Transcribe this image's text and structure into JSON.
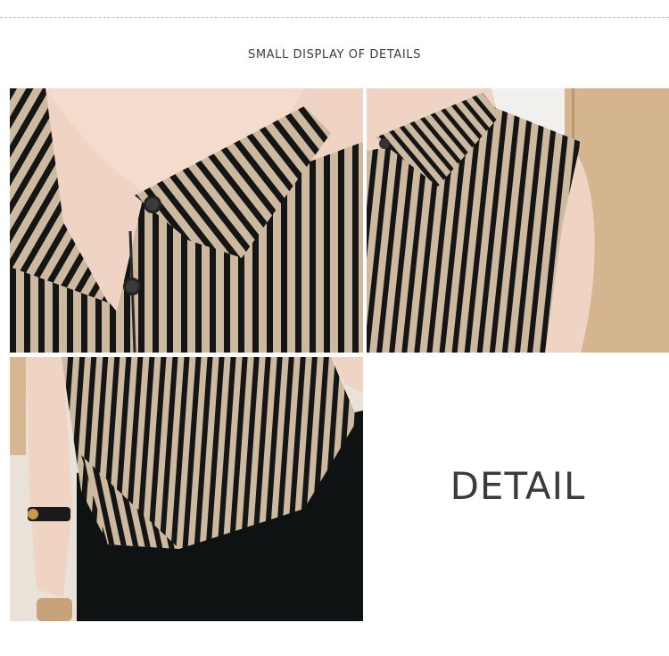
{
  "header": {
    "title": "SMALL DISPLAY OF DETAILS"
  },
  "detail_panel": {
    "label": "DETAIL"
  },
  "photos": [
    {
      "subject": "collar-closeup"
    },
    {
      "subject": "sleeveless-side"
    },
    {
      "subject": "hem-and-skirt"
    }
  ],
  "colors": {
    "stripe_dark": "#151515",
    "stripe_light": "#cdb9a0",
    "skin": "#efd3c3",
    "skirt": "#0f1212"
  }
}
